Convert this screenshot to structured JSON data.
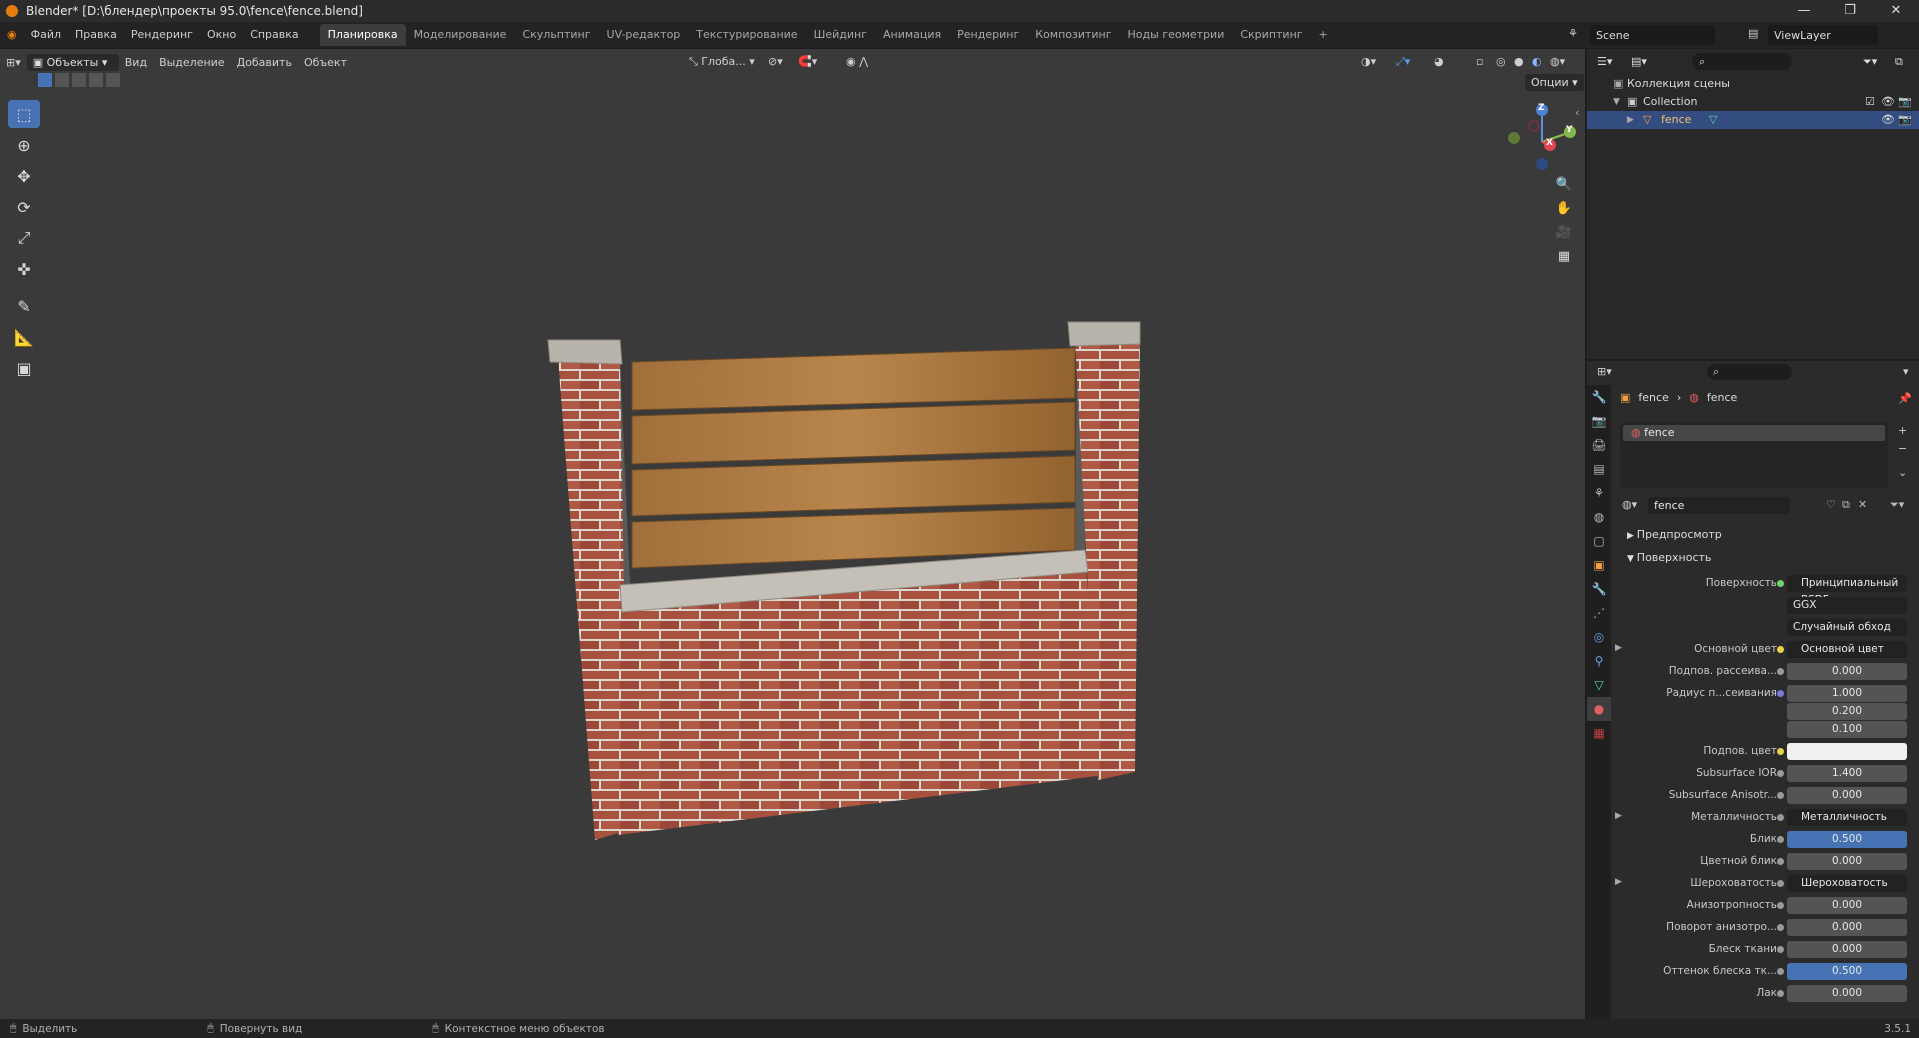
{
  "window": {
    "title": "Blender* [D:\\блендер\\проекты 95.0\\fence\\fence.blend]",
    "controls": [
      "—",
      "❐",
      "✕"
    ]
  },
  "menu": [
    "Файл",
    "Правка",
    "Рендеринг",
    "Окно",
    "Справка"
  ],
  "workspaces": [
    {
      "label": "Планировка",
      "active": true
    },
    {
      "label": "Моделирование"
    },
    {
      "label": "Скульптинг"
    },
    {
      "label": "UV-редактор"
    },
    {
      "label": "Текстурирование"
    },
    {
      "label": "Шейдинг"
    },
    {
      "label": "Анимация"
    },
    {
      "label": "Рендеринг"
    },
    {
      "label": "Композитинг"
    },
    {
      "label": "Ноды геометрии"
    },
    {
      "label": "Скриптинг"
    },
    {
      "label": "+"
    }
  ],
  "scene": {
    "label": "Scene"
  },
  "viewlayer": {
    "label": "ViewLayer"
  },
  "viewport_header": {
    "mode": "Объекты",
    "menus": [
      "Вид",
      "Выделение",
      "Добавить",
      "Объект"
    ],
    "orientation": "Глоба...",
    "options": "Опции"
  },
  "gizmo": {
    "z": "Z",
    "y": "Y",
    "x": "X"
  },
  "outliner": {
    "root": "Коллекция сцены",
    "collection": "Collection",
    "object": "fence"
  },
  "properties": {
    "breadcrumb": [
      "fence",
      "fence"
    ],
    "material_slot": "fence",
    "material_name": "fence",
    "panels": {
      "preview": "Предпросмотр",
      "surface": "Поверхность"
    },
    "rows": [
      {
        "label": "Поверхность",
        "value": "Принципиальный BSDF",
        "kind": "dark",
        "dot": "#6dd36d"
      },
      {
        "label": "",
        "value": "GGX",
        "kind": "dark"
      },
      {
        "label": "",
        "value": "Случайный обход",
        "kind": "dark"
      },
      {
        "label": "Основной цвет",
        "value": "Основной цвет",
        "kind": "dark",
        "dot": "#e8d24a",
        "arrow": true
      },
      {
        "label": "Подпов. рассеива...",
        "value": "0.000",
        "kind": "num",
        "dot": "#9a9a9a"
      },
      {
        "label": "Радиус п...сеивания",
        "value": "1.000",
        "kind": "num",
        "dot": "#7a7ad8"
      },
      {
        "label": "",
        "value": "0.200",
        "kind": "num"
      },
      {
        "label": "",
        "value": "0.100",
        "kind": "num"
      },
      {
        "label": "Подпов. цвет",
        "value": "",
        "kind": "white",
        "dot": "#e8d24a"
      },
      {
        "label": "Subsurface IOR",
        "value": "1.400",
        "kind": "num",
        "dot": "#9a9a9a"
      },
      {
        "label": "Subsurface Anisotr...",
        "value": "0.000",
        "kind": "num",
        "dot": "#9a9a9a"
      },
      {
        "label": "Металличность",
        "value": "Металличность",
        "kind": "dark",
        "dot": "#9a9a9a",
        "arrow": true
      },
      {
        "label": "Блик",
        "value": "0.500",
        "kind": "blue",
        "dot": "#9a9a9a"
      },
      {
        "label": "Цветной блик",
        "value": "0.000",
        "kind": "num",
        "dot": "#9a9a9a"
      },
      {
        "label": "Шероховатость",
        "value": "Шероховатость",
        "kind": "dark",
        "dot": "#9a9a9a",
        "arrow": true
      },
      {
        "label": "Анизотропность",
        "value": "0.000",
        "kind": "num",
        "dot": "#9a9a9a"
      },
      {
        "label": "Поворот анизотро...",
        "value": "0.000",
        "kind": "num",
        "dot": "#9a9a9a"
      },
      {
        "label": "Блеск ткани",
        "value": "0.000",
        "kind": "num",
        "dot": "#9a9a9a"
      },
      {
        "label": "Оттенок блеска тк...",
        "value": "0.500",
        "kind": "blue",
        "dot": "#9a9a9a"
      },
      {
        "label": "Лак",
        "value": "0.000",
        "kind": "num",
        "dot": "#9a9a9a"
      }
    ]
  },
  "status": {
    "select": "Выделить",
    "rotate": "Повернуть вид",
    "context": "Контекстное меню объектов",
    "version": "3.5.1"
  },
  "colors": {
    "accent": "#4772b3",
    "selection": "#334d80",
    "brand": "#e87d0d"
  }
}
